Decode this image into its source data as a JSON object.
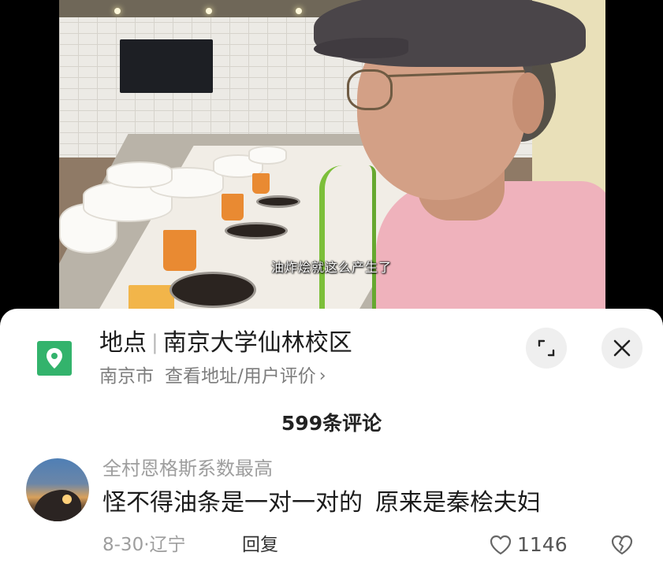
{
  "video": {
    "subtitle": "油炸烩就这么产生了"
  },
  "location": {
    "label": "地点",
    "name": "南京大学仙林校区",
    "city": "南京市",
    "link_text": "查看地址/用户评价"
  },
  "comments": {
    "count_text": "599条评论",
    "items": [
      {
        "username": "全村恩格斯系数最高",
        "text_part1": "怪不得油条是一对一对的",
        "text_part2": "原来是秦桧夫妇",
        "date_location": "8-30·辽宁",
        "reply_label": "回复",
        "likes": "1146"
      }
    ]
  },
  "colors": {
    "location_icon_bg": "#33b36c",
    "sheet_bg": "#ffffff",
    "muted_text": "#9e9e9e"
  },
  "icons": {
    "location": "location-pin-icon",
    "expand": "expand-icon",
    "close": "close-icon",
    "like": "heart-icon",
    "dislike": "broken-heart-icon",
    "chevron": "chevron-right-icon"
  }
}
